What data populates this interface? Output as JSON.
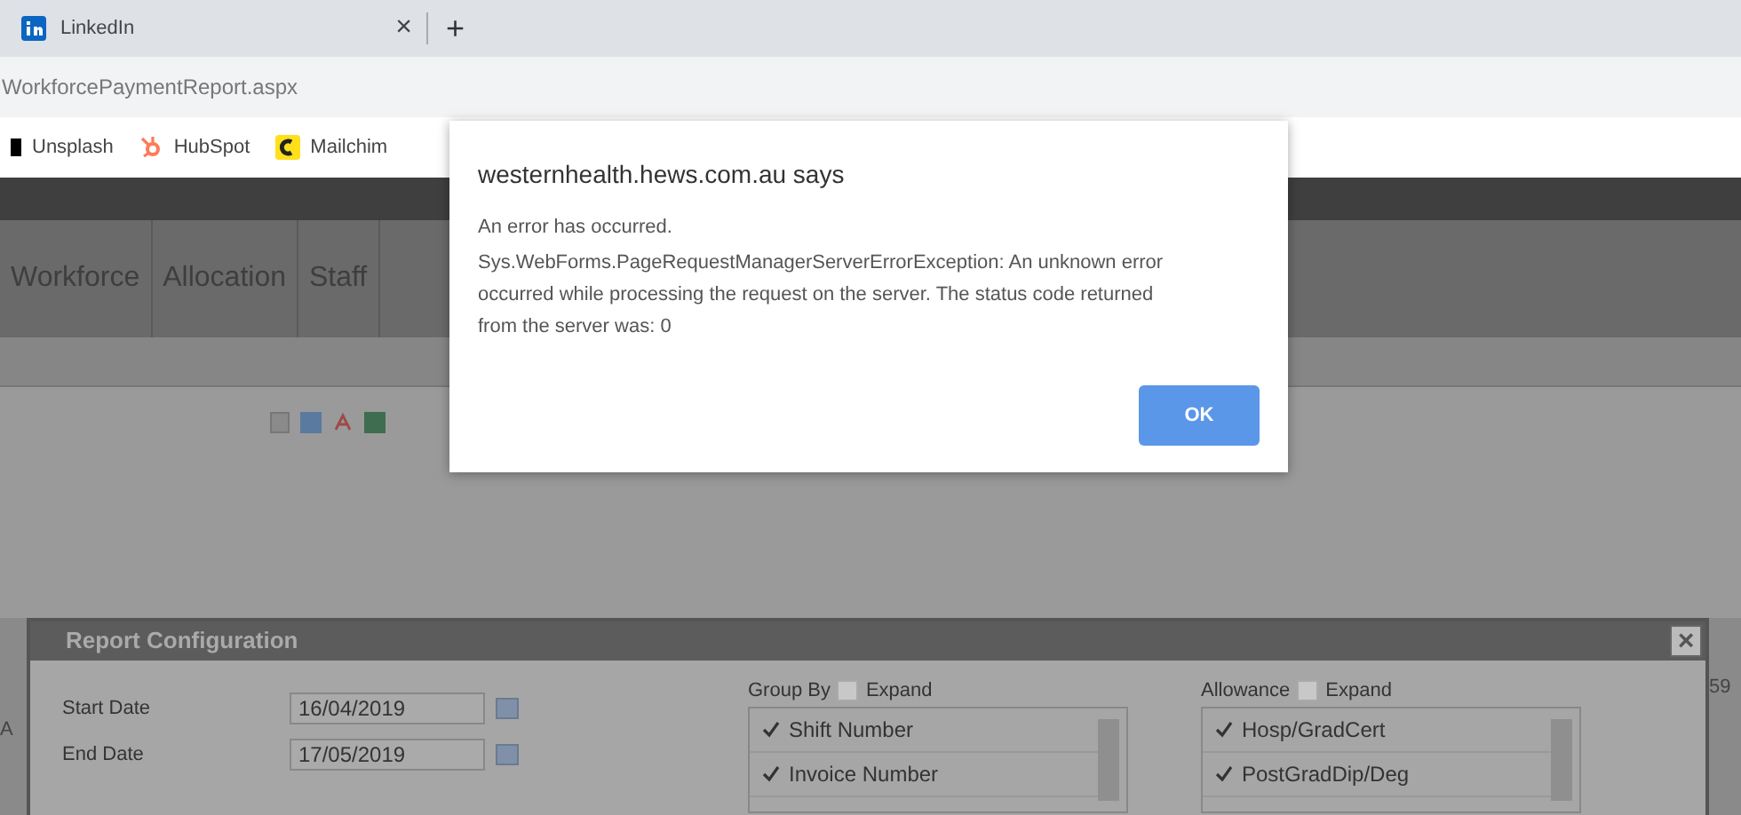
{
  "browser": {
    "tab": {
      "title": "LinkedIn",
      "close": "×"
    },
    "new_tab": "+",
    "address": "WorkforcePaymentReport.aspx",
    "bookmarks": [
      {
        "kind": "dark",
        "label": "Unsplash"
      },
      {
        "kind": "hubspot",
        "label": "HubSpot"
      },
      {
        "kind": "mailchimp",
        "label": "Mailchim"
      }
    ]
  },
  "page": {
    "nav_tabs": [
      "Workforce",
      "Allocation",
      "Staff"
    ],
    "left_fragment": "A",
    "right_fragment": "59"
  },
  "report_config": {
    "title": "Report Configuration",
    "close": "×",
    "dates": [
      {
        "label": "Start Date",
        "value": "16/04/2019"
      },
      {
        "label": "End Date",
        "value": "17/05/2019"
      }
    ],
    "lists": [
      {
        "label": "Group By",
        "expand_label": "Expand",
        "expand_checked": false,
        "items": [
          {
            "label": "Shift Number",
            "checked": true
          },
          {
            "label": "Invoice Number",
            "checked": true
          }
        ]
      },
      {
        "label": "Allowance",
        "expand_label": "Expand",
        "expand_checked": false,
        "items": [
          {
            "label": "Hosp/GradCert",
            "checked": true
          },
          {
            "label": "PostGradDip/Deg",
            "checked": true
          }
        ]
      }
    ]
  },
  "alert": {
    "title": "westernhealth.hews.com.au says",
    "lines": [
      "An error has occurred.",
      "Sys.WebForms.PageRequestManagerServerErrorException: An unknown error occurred while processing the request on the server. The status code returned from the server was: 0"
    ],
    "button": "OK"
  }
}
